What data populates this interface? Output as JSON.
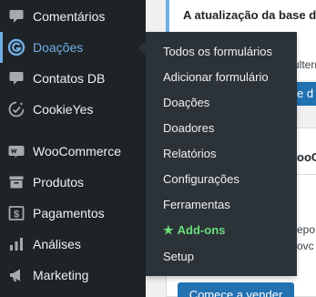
{
  "notice": {
    "title": "A atualização da base d",
    "fragment_line": "ulterna",
    "button_fragment": "e d"
  },
  "card": {
    "title_fragment": "ooC",
    "line_a": "epo",
    "line_b": "ovc",
    "start_button": "Comece a vender"
  },
  "sidebar": {
    "items": [
      {
        "label": "Comentários",
        "icon": "comment-icon"
      },
      {
        "label": "Doações",
        "icon": "givewp-icon",
        "active": true
      },
      {
        "label": "Contatos DB",
        "icon": "contact-db-icon"
      },
      {
        "label": "CookieYes",
        "icon": "cookieyes-icon"
      },
      {
        "label": "WooCommerce",
        "icon": "woocommerce-icon"
      },
      {
        "label": "Produtos",
        "icon": "archive-icon"
      },
      {
        "label": "Pagamentos",
        "icon": "dollar-icon"
      },
      {
        "label": "Análises",
        "icon": "bar-chart-icon"
      },
      {
        "label": "Marketing",
        "icon": "megaphone-icon"
      }
    ]
  },
  "flyout": {
    "items": [
      "Todos os formulários",
      "Adicionar formulário",
      "Doações",
      "Doadores",
      "Relatórios",
      "Configurações",
      "Ferramentas",
      "Add-ons",
      "Setup"
    ],
    "addons_color": "#68de7c"
  },
  "colors": {
    "sidebar_bg": "#1d2327",
    "flyout_bg": "#2c3338",
    "accent": "#72aee6",
    "primary_button": "#2271b1"
  }
}
